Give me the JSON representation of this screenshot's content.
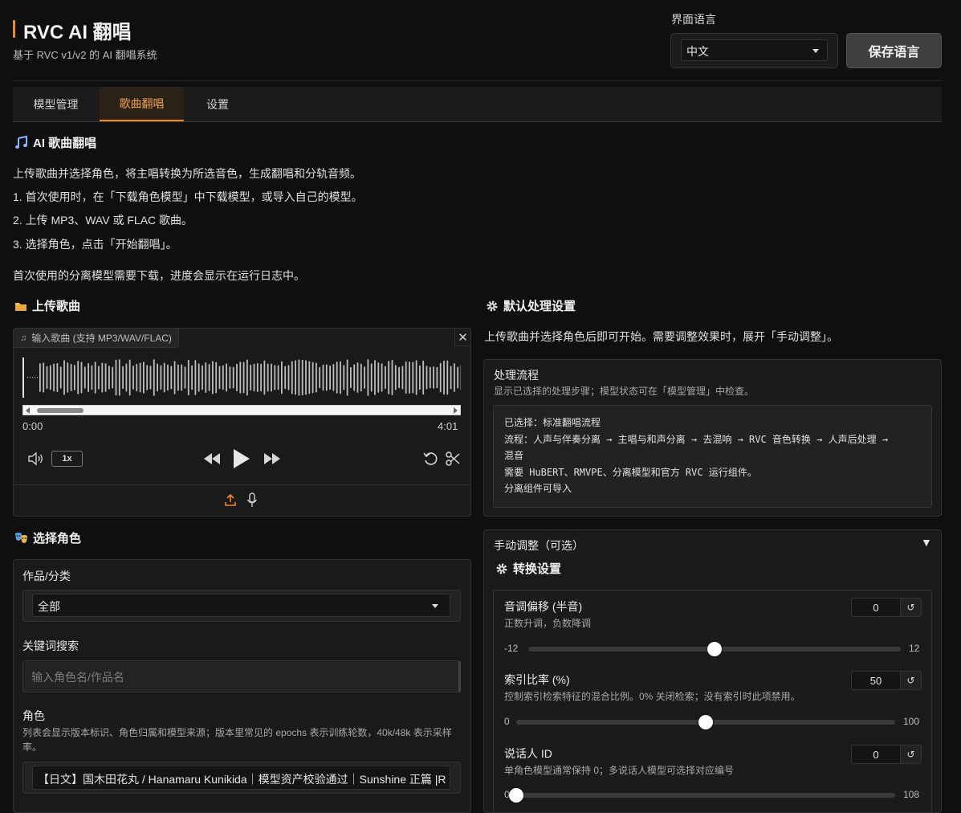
{
  "header": {
    "title": "RVC AI 翻唱",
    "subtitle": "基于 RVC v1/v2 的 AI 翻唱系统",
    "language_label": "界面语言",
    "language_value": "中文",
    "save_button": "保存语言",
    "accent": "#f08a24"
  },
  "tabs": [
    {
      "label": "模型管理"
    },
    {
      "label": "歌曲翻唱"
    },
    {
      "label": "设置"
    }
  ],
  "intro": {
    "heading": "AI 歌曲翻唱",
    "lines": [
      "上传歌曲并选择角色，将主唱转换为所选音色，生成翻唱和分轨音频。",
      "1. 首次使用时，在「下载角色模型」中下载模型，或导入自己的模型。",
      "2. 上传 MP3、WAV 或 FLAC 歌曲。",
      "3. 选择角色，点击「开始翻唱」。",
      "首次使用的分离模型需要下载，进度会显示在运行日志中。"
    ]
  },
  "upload": {
    "heading": "上传歌曲",
    "input_label": "输入歌曲 (支持 MP3/WAV/FLAC)",
    "time_start": "0:00",
    "time_end": "4:01",
    "speed": "1x"
  },
  "role": {
    "heading": "选择角色",
    "category_label": "作品/分类",
    "category_value": "全部",
    "search_label": "关键词搜索",
    "search_placeholder": "输入角色名/作品名",
    "role_label": "角色",
    "role_desc": "列表会显示版本标识、角色归属和模型来源；版本里常见的 epochs 表示训练轮数，40k/48k 表示采样率。",
    "role_value": "【日文】国木田花丸 / Hanamaru Kunikida｜模型资产校验通过｜Sunshine 正篇 |R"
  },
  "defaults": {
    "heading": "默认处理设置",
    "desc": "上传歌曲并选择角色后即可开始。需要调整效果时，展开「手动调整」。",
    "flow_title": "处理流程",
    "flow_desc": "显示已选择的处理步骤；模型状态可在「模型管理」中检查。",
    "flow_lines": [
      "已选择：标准翻唱流程",
      "流程：人声与伴奏分离 → 主唱与和声分离 → 去混响 → RVC 音色转换 → 人声后处理 →",
      "混音",
      "需要 HuBERT、RMVPE、分离模型和官方 RVC 运行组件。",
      "分离组件可导入"
    ]
  },
  "manual": {
    "heading": "手动调整（可选）",
    "toggle": "▼",
    "sub_heading": "转换设置",
    "sliders": [
      {
        "title": "音调偏移 (半音)",
        "desc": "正数升调，负数降调",
        "value": "0",
        "min": "-12",
        "max": "12",
        "min_num": -12,
        "max_num": 12,
        "val_num": 0
      },
      {
        "title": "索引比率 (%)",
        "desc": "控制索引检索特征的混合比例。0% 关闭检索；没有索引时此项禁用。",
        "value": "50",
        "min": "0",
        "max": "100",
        "min_num": 0,
        "max_num": 100,
        "val_num": 50
      },
      {
        "title": "说话人 ID",
        "desc": "单角色模型通常保持 0；多说话人模型可选择对应编号",
        "value": "0",
        "min": "0",
        "max": "108",
        "min_num": 0,
        "max_num": 108,
        "val_num": 0
      }
    ]
  }
}
